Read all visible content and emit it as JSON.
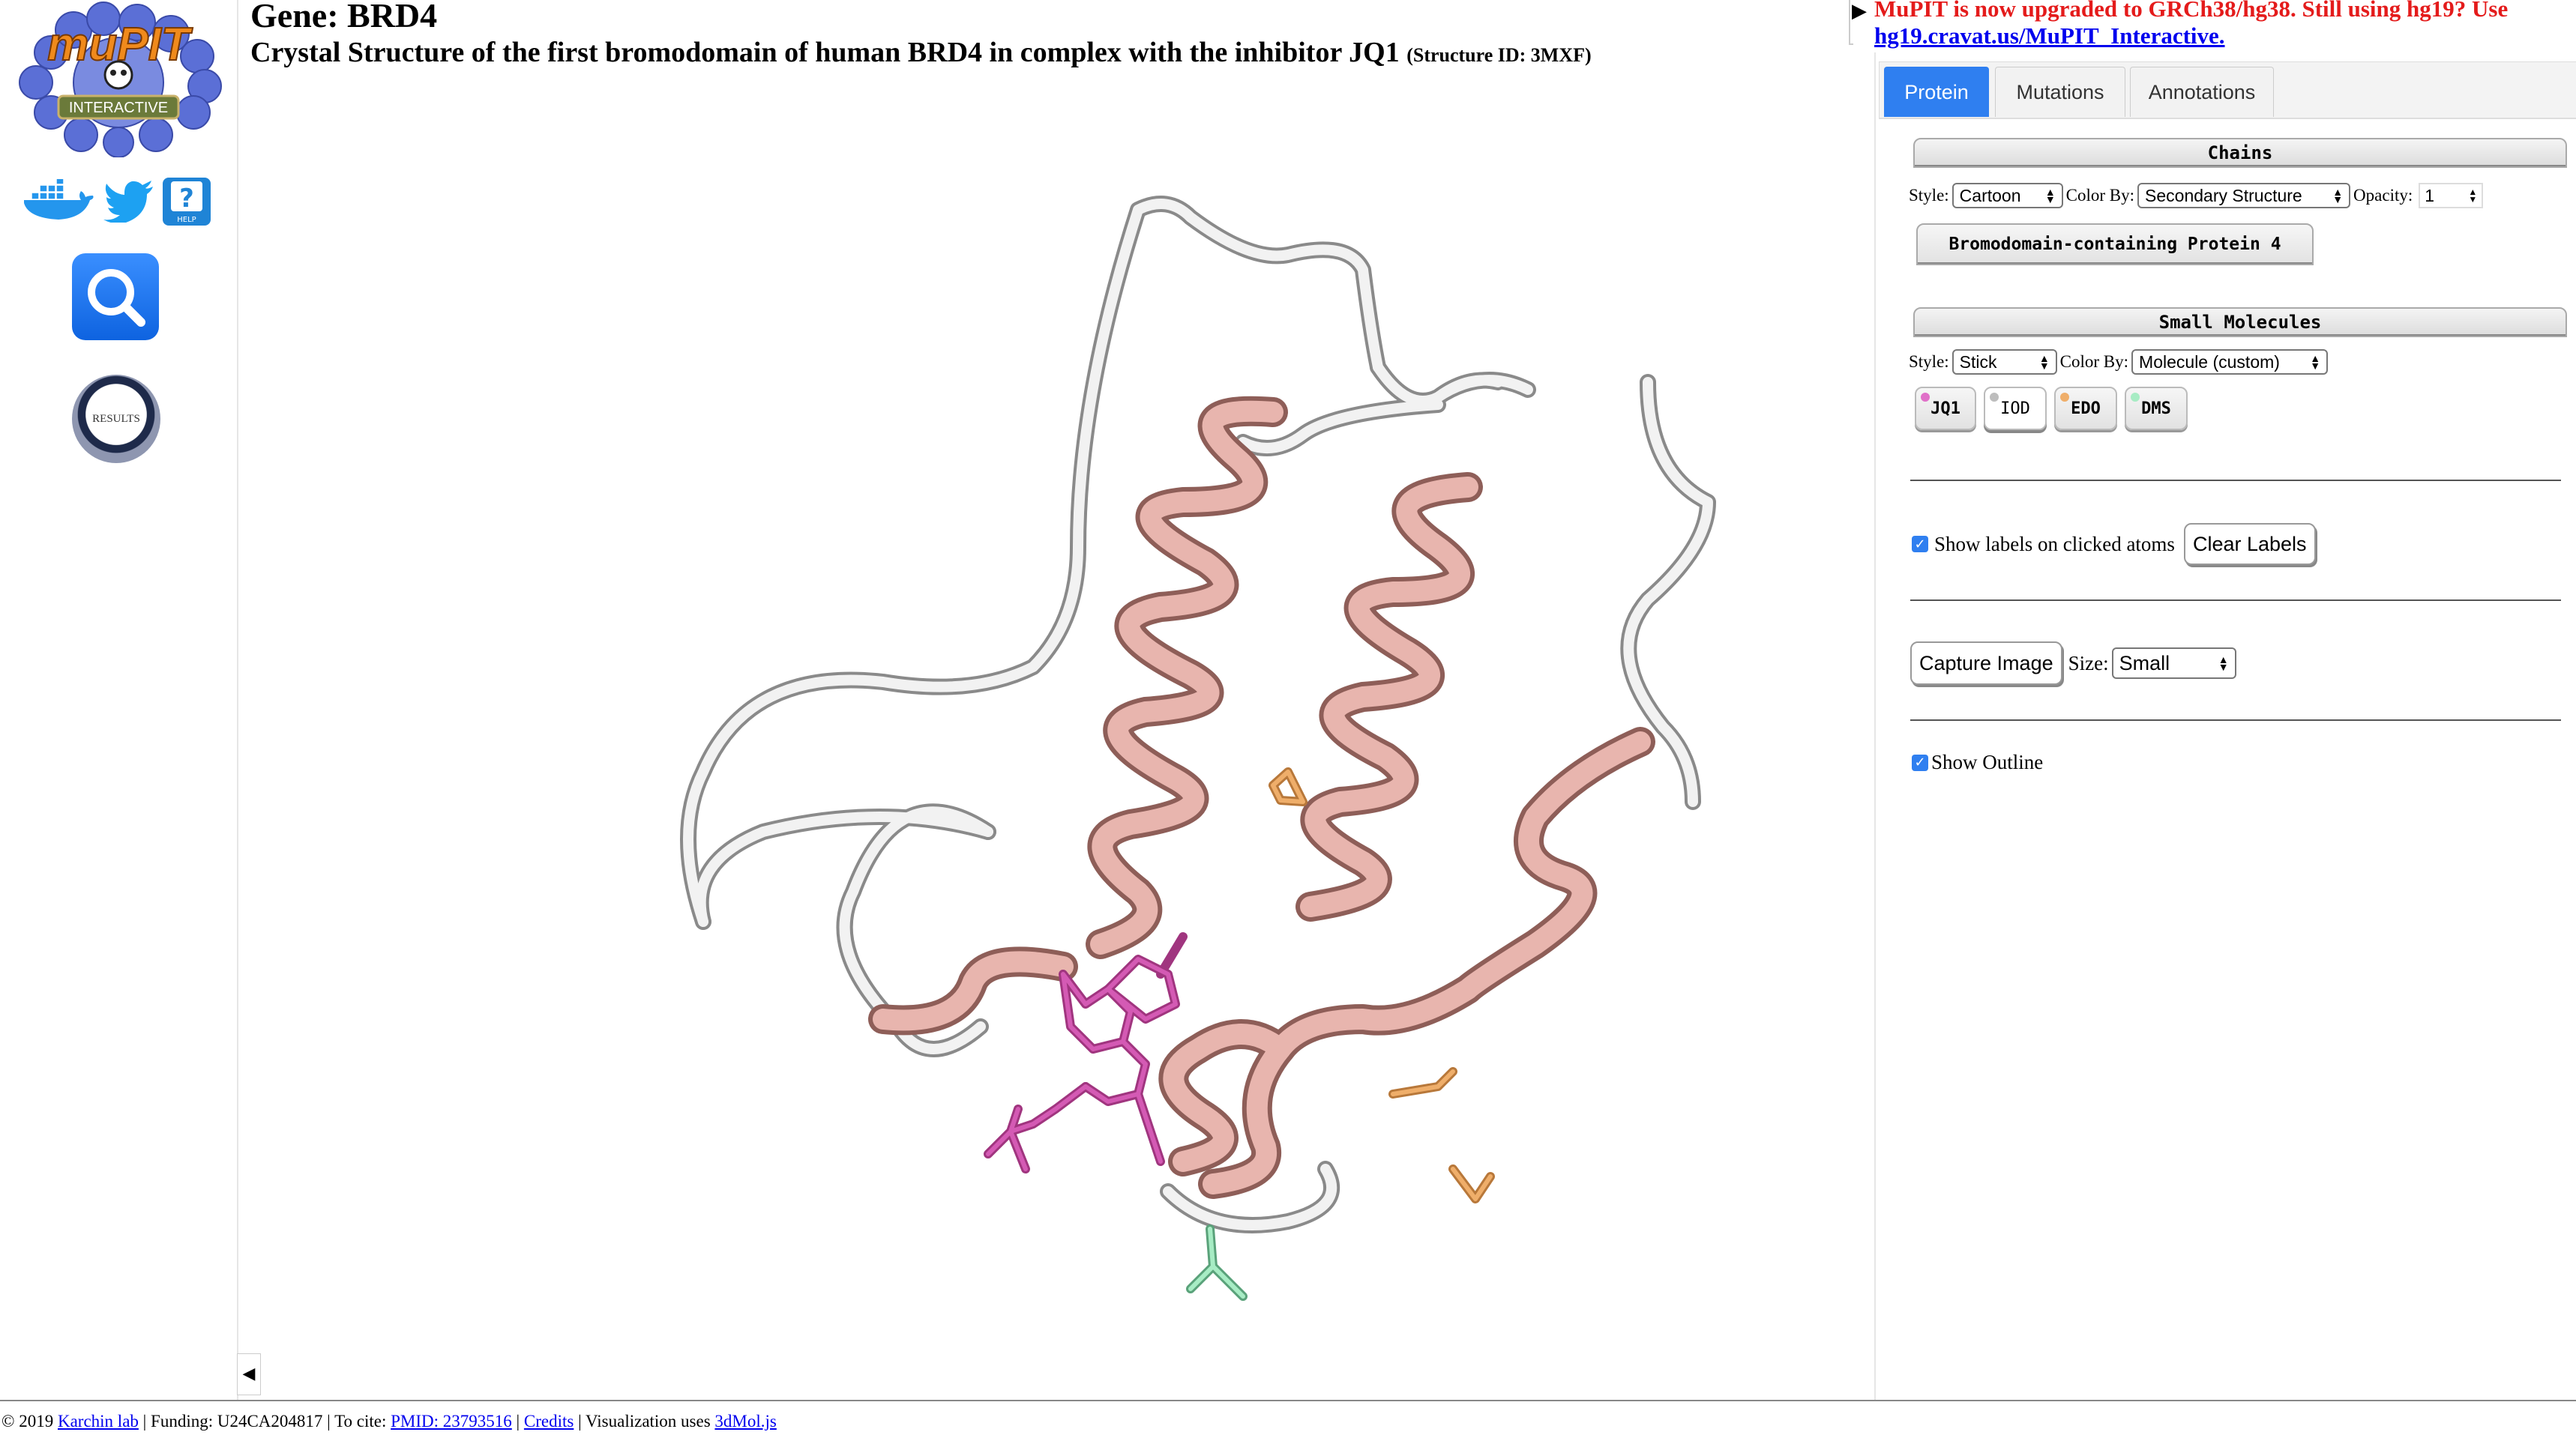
{
  "sidebar": {
    "logo_text": "muPIT",
    "logo_sub": "INTERACTIVE",
    "help_label": "HELP",
    "results_label": "RESULTS"
  },
  "header": {
    "gene": "Gene: BRD4",
    "structure_title": "Crystal Structure of the first bromodomain of human BRD4 in complex with the inhibitor JQ1",
    "structure_id": "(Structure ID: 3MXF)"
  },
  "notice": {
    "text": "MuPIT is now upgraded to GRCh38/hg38. Still using hg19? Use ",
    "link": "hg19.cravat.us/MuPIT_Interactive."
  },
  "tabs": [
    {
      "label": "Protein",
      "active": true
    },
    {
      "label": "Mutations",
      "active": false
    },
    {
      "label": "Annotations",
      "active": false
    }
  ],
  "chains": {
    "header": "Chains",
    "style_label": "Style:",
    "style_value": "Cartoon",
    "colorby_label": "Color By:",
    "colorby_value": "Secondary Structure",
    "opacity_label": "Opacity:",
    "opacity_value": "1",
    "chain_name": "Bromodomain-containing Protein 4"
  },
  "small_molecules": {
    "header": "Small Molecules",
    "style_label": "Style:",
    "style_value": "Stick",
    "colorby_label": "Color By:",
    "colorby_value": "Molecule (custom)",
    "molecules": [
      {
        "label": "JQ1",
        "color": "#c0439a",
        "pressed": false
      },
      {
        "label": "IOD",
        "color": "#bdbdbd",
        "pressed": true
      },
      {
        "label": "EDO",
        "color": "#e1a05a",
        "pressed": false
      },
      {
        "label": "DMS",
        "color": "#9be3b8",
        "pressed": false
      }
    ]
  },
  "labels": {
    "show_labels": "Show labels on clicked atoms",
    "clear_labels": "Clear Labels",
    "capture_image": "Capture Image",
    "size_label": "Size:",
    "size_value": "Small",
    "show_outline": "Show Outline"
  },
  "footer": {
    "copyright": "© 2019 ",
    "lab": "Karchin lab",
    "funding": " | Funding: U24CA204817 | To cite: ",
    "pmid": "PMID: 23793516",
    "sep": " | ",
    "credits": "Credits",
    "viz": " | Visualization uses ",
    "lib": "3dMol.js"
  },
  "colors": {
    "helix": "#e8b5ae",
    "coil": "#e4e4e4",
    "tab_active": "#2f7ff0",
    "notice": "#e41b1b"
  }
}
